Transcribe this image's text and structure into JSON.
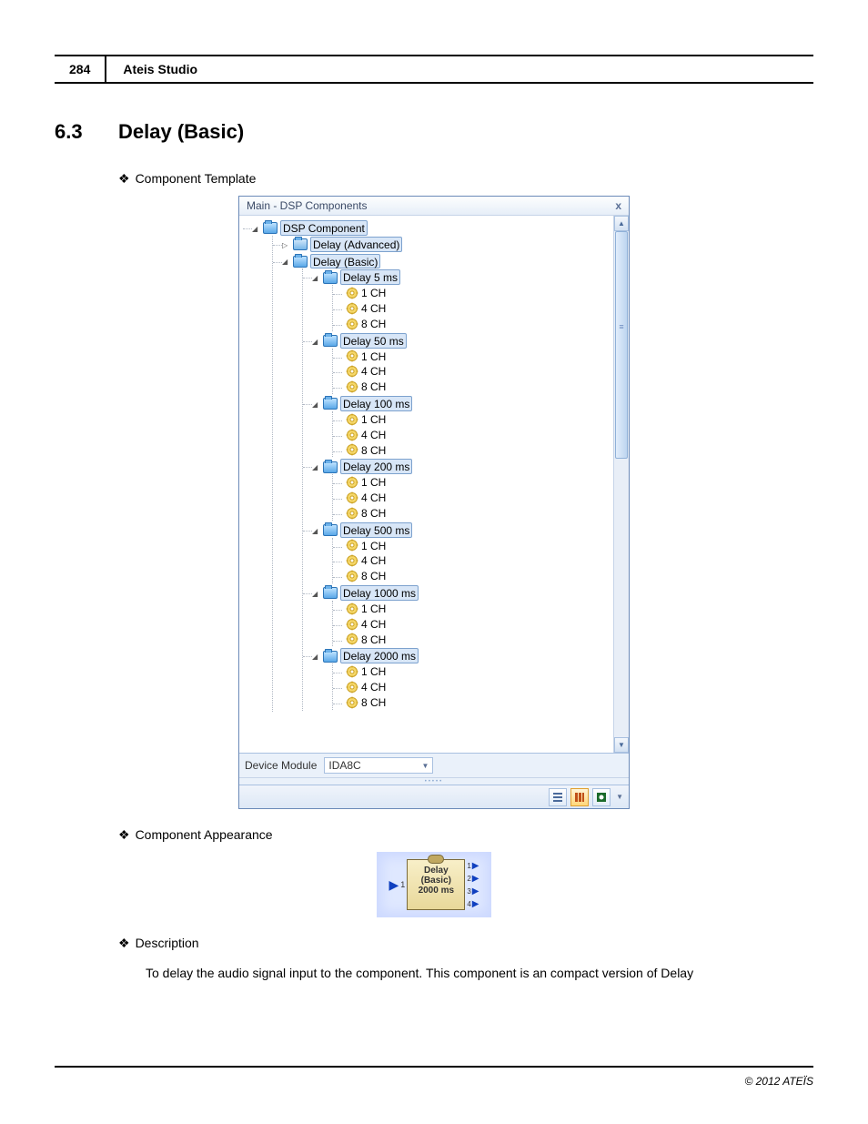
{
  "header": {
    "page_number": "284",
    "title": "Ateis Studio"
  },
  "section": {
    "number": "6.3",
    "title": "Delay (Basic)"
  },
  "bullets": {
    "component_template": "Component Template",
    "component_appearance": "Component Appearance",
    "description": "Description"
  },
  "panel": {
    "title": "Main - DSP Components",
    "device_module_label": "Device Module",
    "device_module_value": "IDA8C",
    "tree": {
      "root": "DSP Component",
      "advanced": "Delay (Advanced)",
      "basic": "Delay (Basic)",
      "groups": [
        "Delay 5 ms",
        "Delay 50 ms",
        "Delay 100 ms",
        "Delay 200 ms",
        "Delay 500 ms",
        "Delay 1000 ms",
        "Delay 2000 ms"
      ],
      "channels": [
        "1 CH",
        "4 CH",
        "8 CH"
      ]
    }
  },
  "component_block": {
    "line1": "Delay",
    "line2": "(Basic)",
    "line3": "2000 ms",
    "input": "1",
    "outputs": [
      "1",
      "2",
      "3",
      "4"
    ]
  },
  "description_text": "To delay the audio signal input to the component. This component is an compact version of Delay",
  "footer": "© 2012 ATEÏS"
}
